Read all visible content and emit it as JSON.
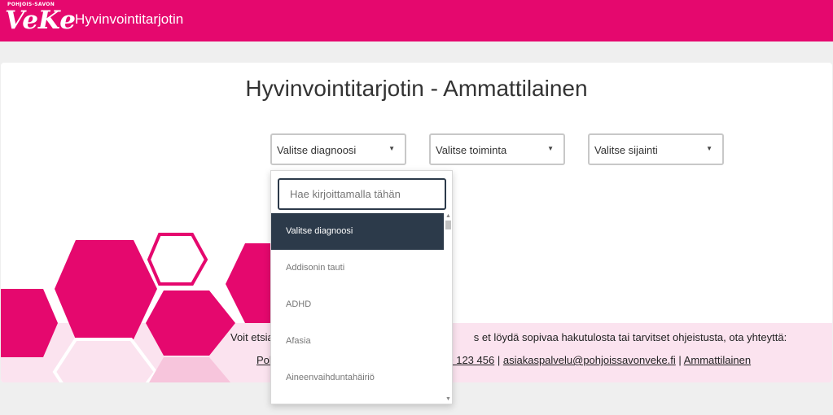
{
  "header": {
    "logo_small": "POHJOIS-SAVON",
    "logo_big": "VeKe",
    "app_title": "Hyvinvointitarjotin"
  },
  "main": {
    "page_title": "Hyvinvointitarjotin - Ammattilainen",
    "selects": [
      {
        "label": "Valitse diagnoosi"
      },
      {
        "label": "Valitse toiminta"
      },
      {
        "label": "Valitse sijainti"
      }
    ],
    "info_text": "Voit etsia",
    "info_text_end": "s et löydä sopivaa hakutulosta tai tarvitset ohjeistusta, ota yhteyttä:",
    "contact_prefix": "Poh",
    "phone": "00 123 456",
    "separator": "|",
    "email": "asiakaspalvelu@pohjoissavonveke.fi",
    "role_link": "Ammattilainen"
  },
  "dropdown": {
    "search_placeholder": "Hae kirjoittamalla tähän",
    "options": [
      "Valitse diagnoosi",
      "Addisonin tauti",
      "ADHD",
      "Afasia",
      "Aineenvaihduntahäiriö"
    ]
  },
  "colors": {
    "brand": "#e5086e",
    "dropdown_active": "#2c3a4a",
    "light_pink": "#fbe3ef"
  }
}
